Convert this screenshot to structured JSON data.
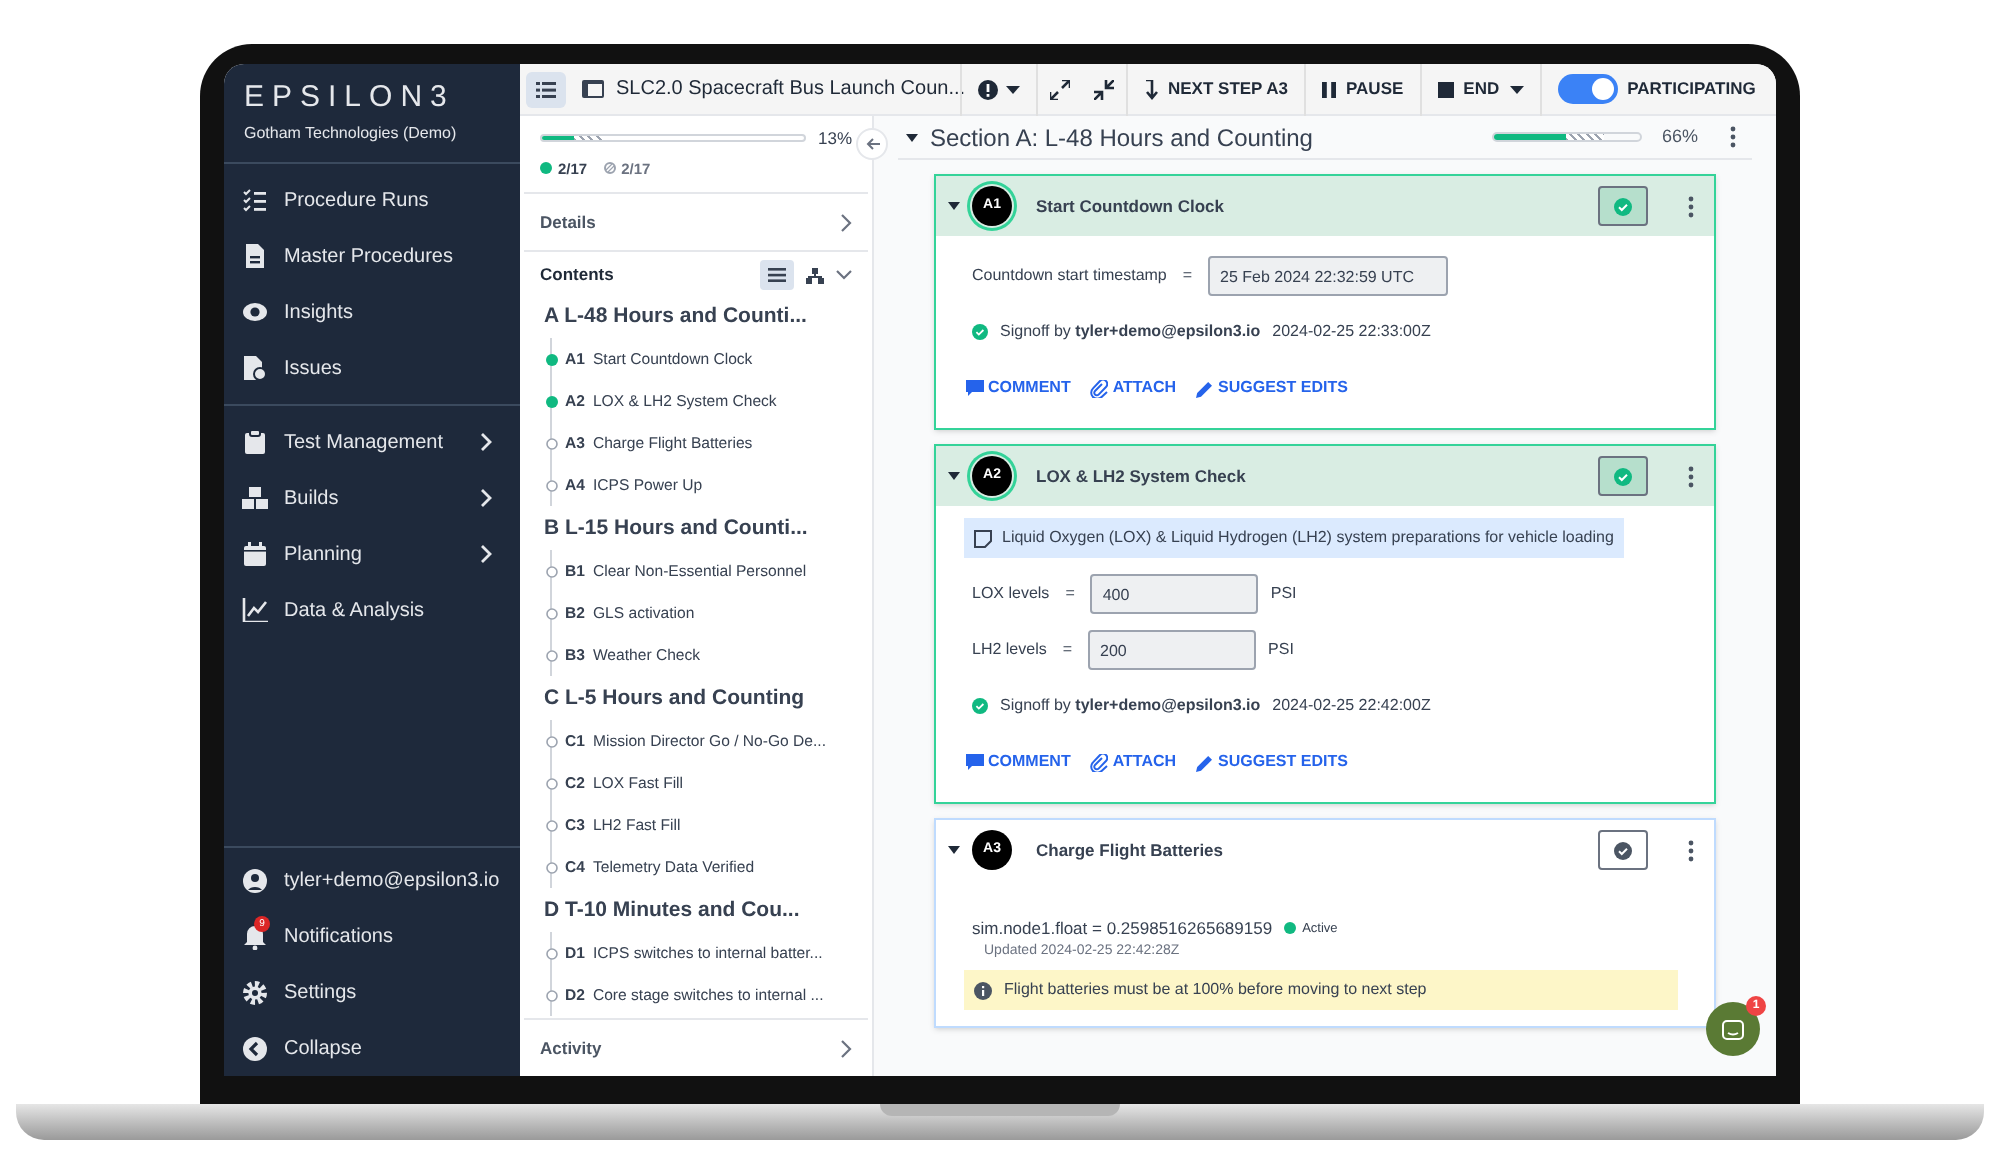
{
  "brand": {
    "logo": "EPSILON3",
    "org": "Gotham Technologies (Demo)"
  },
  "sidebar": {
    "groups": [
      [
        {
          "label": "Procedure Runs",
          "submenu": false
        },
        {
          "label": "Master Procedures",
          "submenu": false
        },
        {
          "label": "Insights",
          "submenu": false
        },
        {
          "label": "Issues",
          "submenu": false
        }
      ],
      [
        {
          "label": "Test Management",
          "submenu": true
        },
        {
          "label": "Builds",
          "submenu": true
        },
        {
          "label": "Planning",
          "submenu": true
        },
        {
          "label": "Data & Analysis",
          "submenu": false
        }
      ]
    ],
    "footer": [
      {
        "label": "tyler+demo@epsilon3.io"
      },
      {
        "label": "Notifications",
        "badge": "9"
      },
      {
        "label": "Settings"
      },
      {
        "label": "Collapse"
      }
    ]
  },
  "toolbar": {
    "title": "SLC2.0 Spacecraft Bus Launch Coun...",
    "next_step": "NEXT STEP A3",
    "pause": "PAUSE",
    "end": "END",
    "participating": {
      "label": "PARTICIPATING",
      "on": true
    }
  },
  "outline": {
    "progress": {
      "level": 0.12,
      "percent": "13%",
      "completed": "2/17",
      "signed": "2/17"
    },
    "details": "Details",
    "contents": "Contents",
    "activity": "Activity",
    "sections": [
      {
        "title": "A L-48 Hours and Counti...",
        "steps": [
          {
            "id": "A1",
            "label": "Start Countdown Clock",
            "done": true
          },
          {
            "id": "A2",
            "label": "LOX & LH2 System Check",
            "done": true
          },
          {
            "id": "A3",
            "label": "Charge Flight Batteries",
            "done": false
          },
          {
            "id": "A4",
            "label": "ICPS Power Up",
            "done": false
          }
        ]
      },
      {
        "title": "B L-15 Hours and Counti...",
        "steps": [
          {
            "id": "B1",
            "label": "Clear Non-Essential Personnel",
            "done": false
          },
          {
            "id": "B2",
            "label": "GLS activation",
            "done": false
          },
          {
            "id": "B3",
            "label": "Weather Check",
            "done": false
          }
        ]
      },
      {
        "title": "C L-5 Hours and Counting",
        "steps": [
          {
            "id": "C1",
            "label": "Mission Director Go / No-Go De...",
            "done": false
          },
          {
            "id": "C2",
            "label": "LOX Fast Fill",
            "done": false
          },
          {
            "id": "C3",
            "label": "LH2 Fast Fill",
            "done": false
          },
          {
            "id": "C4",
            "label": "Telemetry Data Verified",
            "done": false
          }
        ]
      },
      {
        "title": "D T-10 Minutes and Cou...",
        "steps": [
          {
            "id": "D1",
            "label": "ICPS switches to internal batter...",
            "done": false
          },
          {
            "id": "D2",
            "label": "Core stage switches to internal ...",
            "done": false
          }
        ]
      }
    ]
  },
  "section": {
    "title": "Section A: L-48 Hours and Counting",
    "level": 0.5,
    "percent": "66%"
  },
  "steps": [
    {
      "id": "A1",
      "title": "Start Countdown Clock",
      "complete": true,
      "blocks": [
        {
          "kind": "field",
          "label": "Countdown start timestamp",
          "operator": "=",
          "value": "25 Feb 2024 22:32:59 UTC"
        },
        {
          "kind": "signoff",
          "text": "Signoff by **tyler+demo@epsilon3.io**",
          "time": "2024-02-25 22:33:00Z"
        }
      ],
      "actions": [
        "COMMENT",
        "ATTACH",
        "SUGGEST EDITS"
      ]
    },
    {
      "id": "A2",
      "title": "LOX & LH2 System Check",
      "complete": true,
      "blocks": [
        {
          "kind": "note",
          "text": "Liquid Oxygen (LOX) & Liquid Hydrogen (LH2) system preparations for vehicle loading"
        },
        {
          "kind": "field",
          "label": "LOX levels",
          "operator": "=",
          "value": "400",
          "unit": "PSI"
        },
        {
          "kind": "field",
          "label": "LH2 levels",
          "operator": "=",
          "value": "200",
          "unit": "PSI"
        },
        {
          "kind": "signoff",
          "text": "Signoff by **tyler+demo@epsilon3.io**",
          "time": "2024-02-25 22:42:00Z"
        }
      ],
      "actions": [
        "COMMENT",
        "ATTACH",
        "SUGGEST EDITS"
      ]
    },
    {
      "id": "A3",
      "title": "Charge Flight Batteries",
      "complete": false,
      "blocks": [
        {
          "kind": "telemetry",
          "text": "sim.node1.float = 0.2598516265689159",
          "status": "Active",
          "updated": "Updated 2024-02-25 22:42:28Z"
        },
        {
          "kind": "alert",
          "text": "Flight batteries must be at 100% before moving to next step"
        }
      ]
    }
  ],
  "chat": {
    "badge": "1"
  }
}
